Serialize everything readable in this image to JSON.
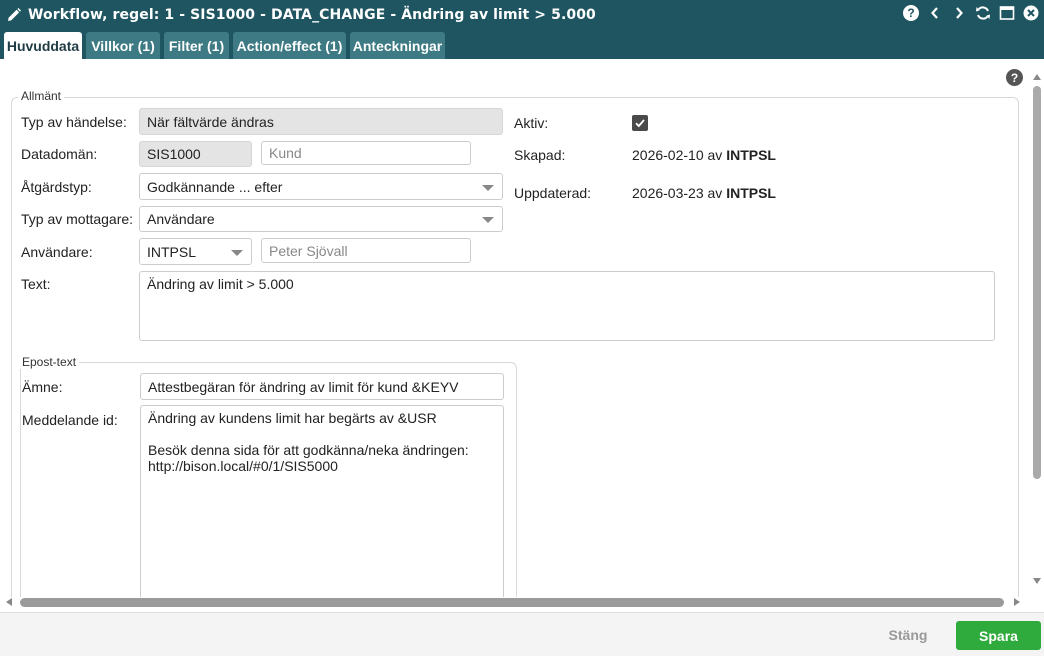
{
  "window": {
    "title": "Workflow, regel: 1 - SIS1000 - DATA_CHANGE - Ändring av limit > 5.000",
    "help": "?"
  },
  "tabs": [
    {
      "label": "Huvuddata",
      "active": true
    },
    {
      "label": "Villkor (1)"
    },
    {
      "label": "Filter (1)"
    },
    {
      "label": "Action/effect (1)"
    },
    {
      "label": "Anteckningar"
    }
  ],
  "general": {
    "legend": "Allmänt",
    "event_type_label": "Typ av händelse:",
    "event_type_value": "När fältvärde ändras",
    "data_domain_label": "Datadomän:",
    "data_domain_value": "SIS1000",
    "data_domain_desc": "Kund",
    "action_type_label": "Åtgärdstyp:",
    "action_type_value": "Godkännande ... efter",
    "recipient_type_label": "Typ av mottagare:",
    "recipient_type_value": "Användare",
    "user_label": "Användare:",
    "user_value": "INTPSL",
    "user_name": "Peter Sjövall",
    "text_label": "Text:",
    "text_value": "Ändring av limit > 5.000",
    "active_label": "Aktiv:",
    "active_checked": true,
    "created_label": "Skapad:",
    "created_date": "2026-02-10 av",
    "created_by": "INTPSL",
    "updated_label": "Uppdaterad:",
    "updated_date": "2026-03-23 av",
    "updated_by": "INTPSL"
  },
  "email": {
    "legend": "Epost-text",
    "subject_label": "Ämne:",
    "subject_value": "Attestbegäran för ändring av limit för kund &KEYV",
    "message_label": "Meddelande id:",
    "message_value": "Ändring av kundens limit har begärts av &USR\n\nBesök denna sida för att godkänna/neka ändringen:\nhttp://bison.local/#0/1/SIS5000"
  },
  "footer": {
    "close_label": "Stäng",
    "save_label": "Spara"
  },
  "colors": {
    "titlebar": "#1e5560",
    "tab_inactive": "#3d7a84",
    "save_button": "#2faa3c"
  }
}
